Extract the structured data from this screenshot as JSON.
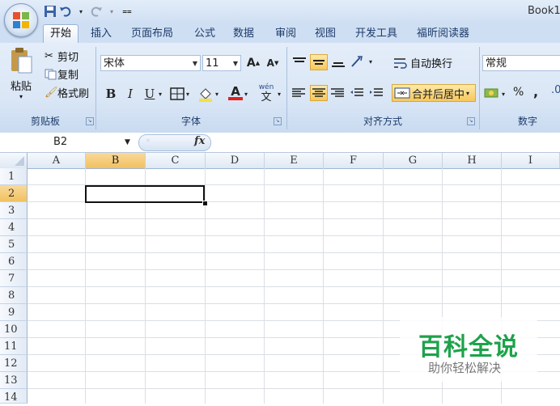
{
  "window": {
    "title": "Book1"
  },
  "tabs": [
    "开始",
    "插入",
    "页面布局",
    "公式",
    "数据",
    "审阅",
    "视图",
    "开发工具",
    "福昕阅读器"
  ],
  "clipboard": {
    "paste": "粘贴",
    "cut": "剪切",
    "copy": "复制",
    "format_painter": "格式刷",
    "group": "剪贴板"
  },
  "font": {
    "name": "宋体",
    "size": "11",
    "group": "字体",
    "bold": "B",
    "italic": "I",
    "underline": "U",
    "grow": "A",
    "shrink": "A",
    "font_color_letter": "A",
    "phonetic": "wén"
  },
  "alignment": {
    "wrap_text": "自动换行",
    "merge_center": "合并后居中",
    "group": "对齐方式"
  },
  "number": {
    "format": "常规",
    "percent": "%",
    "comma": ",",
    "group": "数字"
  },
  "formula_bar": {
    "name_box": "B2",
    "fx": "fx",
    "value": ""
  },
  "columns": [
    "A",
    "B",
    "C",
    "D",
    "E",
    "F",
    "G",
    "H",
    "I"
  ],
  "rows": [
    "1",
    "2",
    "3",
    "4",
    "5",
    "6",
    "7",
    "8",
    "9",
    "10",
    "11",
    "12",
    "13",
    "14"
  ],
  "selection": {
    "cell": "B2"
  },
  "watermark": {
    "title": "百科全说",
    "subtitle": "助你轻松解决"
  },
  "colors": {
    "accent": "#1ea24b",
    "ribbon": "#dbe7f6",
    "selected_header": "#f1c15f"
  },
  "icons": [
    "office-logo-icon",
    "save-icon",
    "undo-icon",
    "redo-icon",
    "customize-qat-icon",
    "paste-icon",
    "cut-icon",
    "copy-icon",
    "format-painter-icon",
    "borders-icon",
    "fill-color-icon",
    "font-color-icon",
    "wrap-text-icon",
    "merge-icon",
    "currency-icon",
    "fx-icon"
  ]
}
